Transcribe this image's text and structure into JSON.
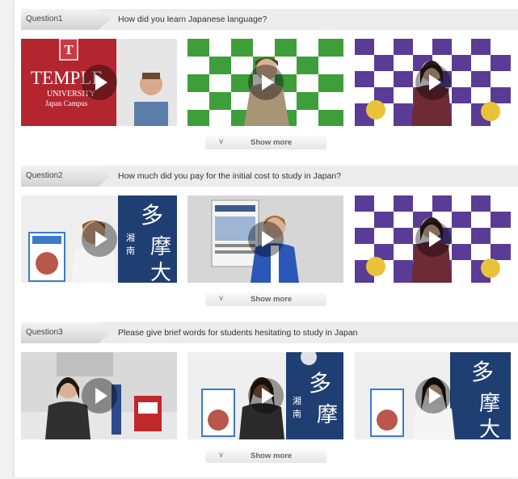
{
  "sections": [
    {
      "label": "Question1",
      "question": "How did you learn Japanese language?",
      "show_more": "Show more"
    },
    {
      "label": "Question2",
      "question": "How much did you pay for the initial cost to study in Japan?",
      "show_more": "Show more"
    },
    {
      "label": "Question3",
      "question": "Please give brief words for students hesitating to study in Japan",
      "show_more": "Show more"
    }
  ],
  "thumb_text": {
    "temple_line1": "TEMPLE",
    "temple_line2": "UNIVERSITY",
    "temple_line3": "Japan Campus",
    "temple_emblem": "T",
    "tama_kanji": [
      "多",
      "摩",
      "大"
    ],
    "shonan_kanji": [
      "湘",
      "南"
    ]
  },
  "icons": {
    "play": "play-icon",
    "show_more": "chevron-down-icon"
  },
  "colors": {
    "temple_red": "#b3262f",
    "tama_blue": "#1f3f73",
    "green_board": "#3e9e3a",
    "purple_board": "#5a3c96"
  }
}
